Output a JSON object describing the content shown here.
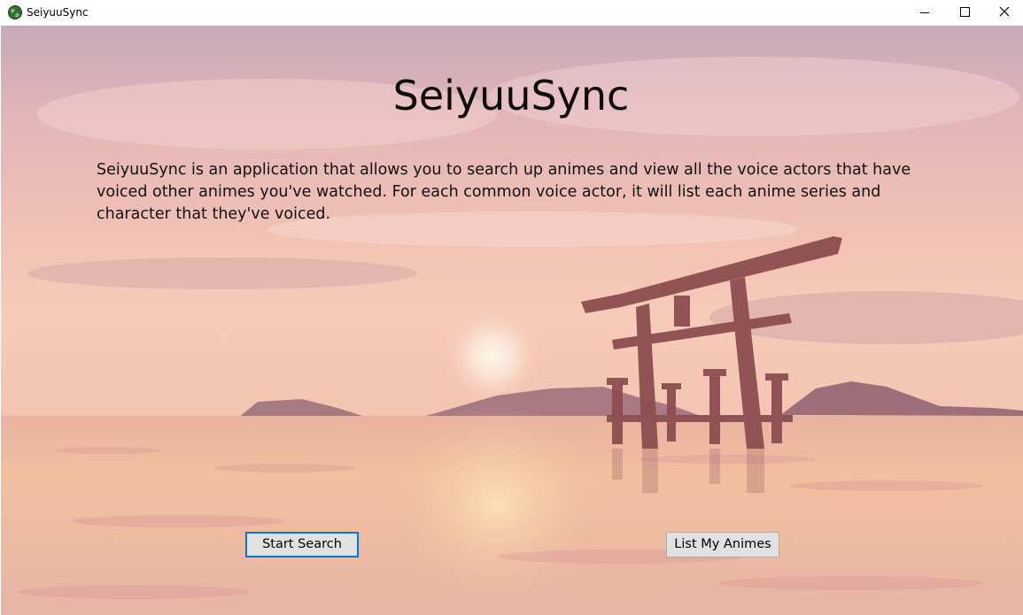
{
  "window": {
    "title": "SeiyuuSync",
    "app_icon": "globe-icon",
    "caption_icons": [
      "minimize-icon",
      "maximize-icon",
      "close-icon"
    ]
  },
  "main": {
    "heading": "SeiyuuSync",
    "description": "SeiyuuSync is an application that allows you to search up animes and view all the voice actors that have voiced other animes you've watched. For each common voice actor, it will list each anime series and character that they've voiced.",
    "background": "sunset-torii-gate-over-water",
    "buttons": {
      "start_search": "Start Search",
      "list_my_animes": "List My Animes"
    }
  },
  "colors": {
    "focus_border": "#0078d7",
    "button_face": "#e1e1e1",
    "sky_top": "#c9a6b6",
    "sky_horizon": "#f2c3b0",
    "water": "#f0b8a0"
  }
}
